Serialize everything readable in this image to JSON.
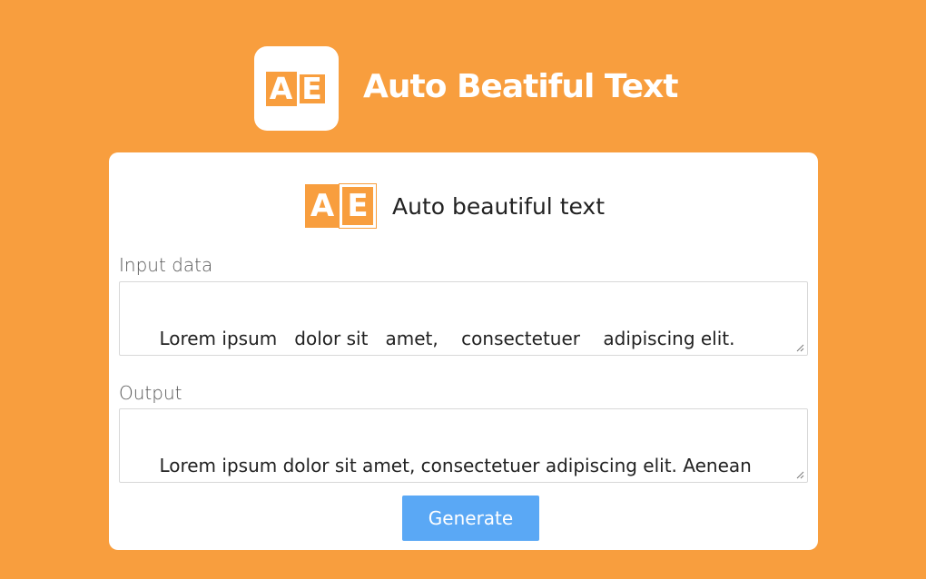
{
  "hero": {
    "logo_letter_a": "A",
    "logo_letter_e": "E",
    "title": "Auto Beatiful Text"
  },
  "card": {
    "logo_letter_a": "A",
    "logo_letter_e": "E",
    "title": "Auto beautiful text",
    "input": {
      "label": "Input data",
      "value": "Lorem ipsum   dolor sit   amet,    consectetuer    adipiscing elit.\nAenean commodo ligula    eget dolor."
    },
    "output": {
      "label": "Output",
      "value": "Lorem ipsum dolor sit amet, consectetuer adipiscing elit. Aenean\ncommodo ligula eget dolor."
    },
    "generate_label": "Generate"
  },
  "colors": {
    "background": "#F89E3E",
    "accent": "#5AA8F5",
    "card": "#FFFFFF"
  }
}
